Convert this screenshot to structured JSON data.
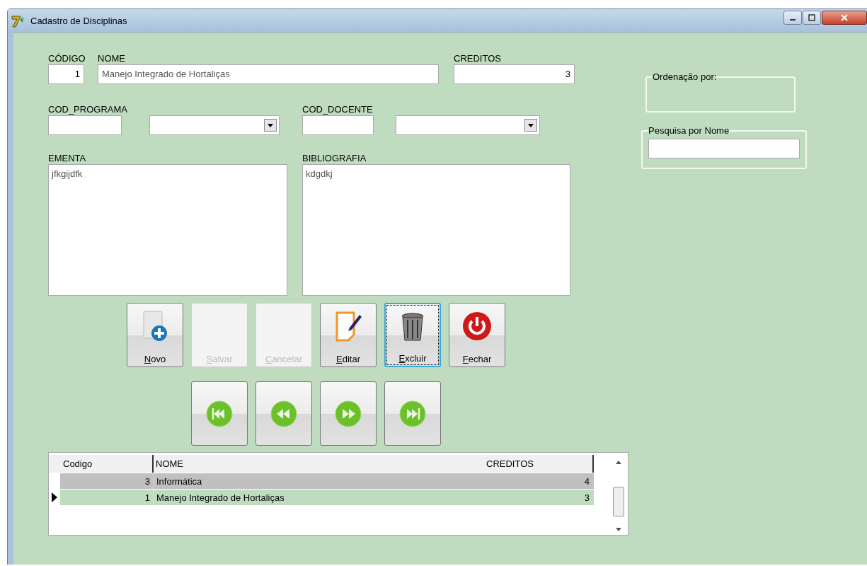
{
  "window": {
    "title": "Cadastro de Disciplinas"
  },
  "codigo": {
    "label": "CÓDIGO",
    "value": "1"
  },
  "nome": {
    "label": "NOME",
    "value": "Manejo Integrado de Hortaliças"
  },
  "creditos": {
    "label": "CREDITOS",
    "value": "3"
  },
  "cod_programa": {
    "label": "COD_PROGRAMA"
  },
  "cod_docente": {
    "label": "COD_DOCENTE"
  },
  "ementa": {
    "label": "EMENTA",
    "value": "jfkgijdfk"
  },
  "bibliografia": {
    "label": "BIBLIOGRAFIA",
    "value": "kdgdkj"
  },
  "sort_group": {
    "title": "Ordenação por:"
  },
  "search_group": {
    "title": "Pesquisa por Nome"
  },
  "buttons": [
    {
      "label": "Novo",
      "kind": "new",
      "disabled": false,
      "focused": false
    },
    {
      "label": "Salvar",
      "kind": "save",
      "disabled": true,
      "focused": false
    },
    {
      "label": "Cancelar",
      "kind": "cancel",
      "disabled": true,
      "focused": false
    },
    {
      "label": "Editar",
      "kind": "edit",
      "disabled": false,
      "focused": false
    },
    {
      "label": "Excluir",
      "kind": "delete",
      "disabled": false,
      "focused": true
    },
    {
      "label": "Fechar",
      "kind": "close",
      "disabled": false,
      "focused": false
    }
  ],
  "navigation": [
    {
      "kind": "first"
    },
    {
      "kind": "previous"
    },
    {
      "kind": "next"
    },
    {
      "kind": "last"
    }
  ],
  "grid": {
    "columns": [
      "Codigo",
      "NOME",
      "CREDITOS"
    ],
    "rows": [
      {
        "codigo": "3",
        "nome": "Informática",
        "creditos": "4",
        "selected": true,
        "current": false
      },
      {
        "codigo": "1",
        "nome": "Manejo Integrado de Hortaliças",
        "creditos": "3",
        "selected": false,
        "current": true
      }
    ]
  }
}
